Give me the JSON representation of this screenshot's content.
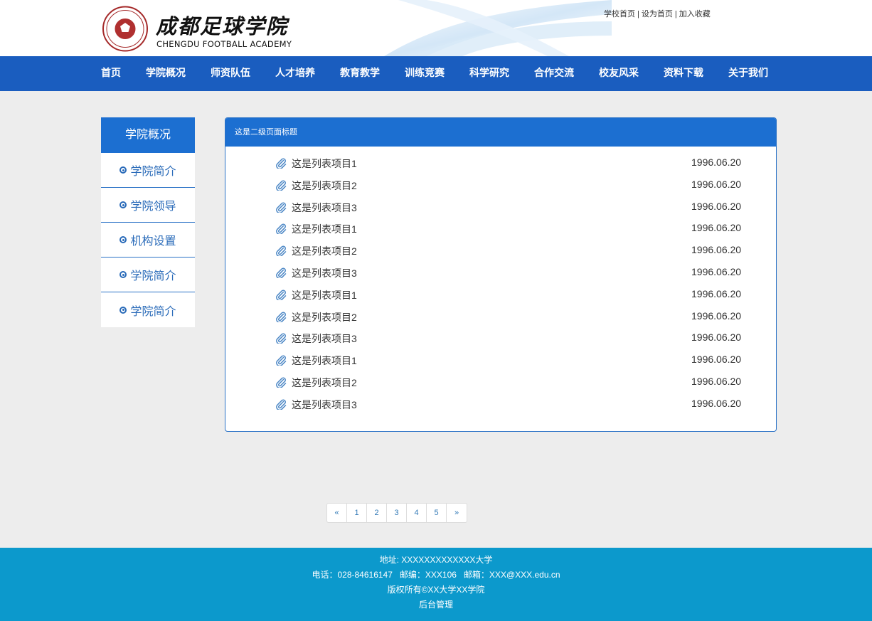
{
  "header": {
    "logo_cn": "成都足球学院",
    "logo_en": "CHENGDU FOOTBALL ACADEMY",
    "toplinks": [
      "学校首页",
      "设为首页",
      "加入收藏"
    ],
    "toplink_sep": "|"
  },
  "nav": {
    "items": [
      "首页",
      "学院概况",
      "师资队伍",
      "人才培养",
      "教育教学",
      "训练竞赛",
      "科学研究",
      "合作交流",
      "校友风采",
      "资料下载",
      "关于我们"
    ]
  },
  "sidebar": {
    "title": "学院概况",
    "items": [
      "学院简介",
      "学院领导",
      "机构设置",
      "学院简介",
      "学院简介"
    ]
  },
  "panel": {
    "title": "这是二级页面标题",
    "items": [
      {
        "title": "这是列表项目1",
        "date": "1996.06.20"
      },
      {
        "title": "这是列表项目2",
        "date": "1996.06.20"
      },
      {
        "title": "这是列表项目3",
        "date": "1996.06.20"
      },
      {
        "title": "这是列表项目1",
        "date": "1996.06.20"
      },
      {
        "title": "这是列表项目2",
        "date": "1996.06.20"
      },
      {
        "title": "这是列表项目3",
        "date": "1996.06.20"
      },
      {
        "title": "这是列表项目1",
        "date": "1996.06.20"
      },
      {
        "title": "这是列表项目2",
        "date": "1996.06.20"
      },
      {
        "title": "这是列表项目3",
        "date": "1996.06.20"
      },
      {
        "title": "这是列表项目1",
        "date": "1996.06.20"
      },
      {
        "title": "这是列表项目2",
        "date": "1996.06.20"
      },
      {
        "title": "这是列表项目3",
        "date": "1996.06.20"
      }
    ]
  },
  "pagination": {
    "prev": "«",
    "pages": [
      "1",
      "2",
      "3",
      "4",
      "5"
    ],
    "next": "»"
  },
  "footer": {
    "address": "地址: XXXXXXXXXXXXX大学",
    "contact": "电话：028-84616147   邮编：XXX106   邮箱：XXX@XXX.edu.cn",
    "copyright": "版权所有©XX大学XX学院",
    "admin": "后台管理"
  },
  "colors": {
    "nav_bg": "#1a5dbf",
    "accent": "#1c6fd1",
    "footer_bg": "#0c99cc",
    "page_bg": "#ededed"
  },
  "icons": {
    "list_item": "paperclip-icon",
    "sidebar_item": "circle-dot-icon",
    "logo": "football-emblem-icon"
  }
}
